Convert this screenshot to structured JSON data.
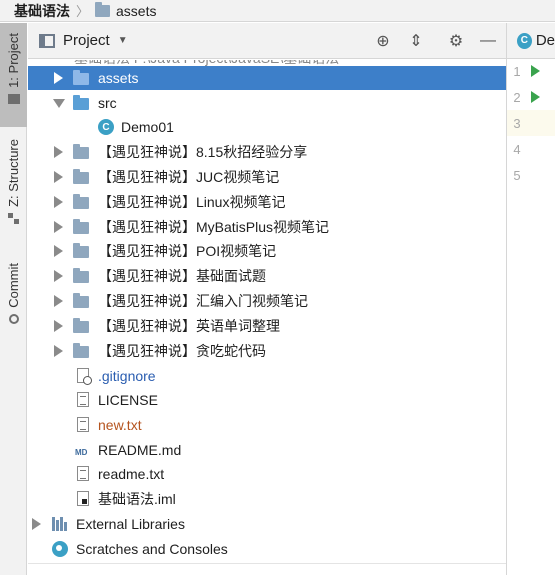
{
  "breadcrumb": {
    "root": "基础语法",
    "folder": "assets"
  },
  "tool_strip": {
    "project_tab": "1: Project",
    "structure_tab": "Z: Structure",
    "commit_tab": "Commit"
  },
  "panel": {
    "title": "Project",
    "header_hint": "基础语法  F:\\Java Project\\JavaSE\\基础语法"
  },
  "tree": [
    {
      "label": "assets",
      "kind": "folder",
      "expanded": false,
      "selected": true
    },
    {
      "label": "src",
      "kind": "source-folder",
      "expanded": true
    },
    {
      "label": "Demo01",
      "kind": "java-class"
    },
    {
      "label": "【遇见狂神说】8.15秋招经验分享",
      "kind": "folder",
      "expanded": false
    },
    {
      "label": "【遇见狂神说】JUC视频笔记",
      "kind": "folder",
      "expanded": false
    },
    {
      "label": "【遇见狂神说】Linux视频笔记",
      "kind": "folder",
      "expanded": false
    },
    {
      "label": "【遇见狂神说】MyBatisPlus视频笔记",
      "kind": "folder",
      "expanded": false
    },
    {
      "label": "【遇见狂神说】POI视频笔记",
      "kind": "folder",
      "expanded": false
    },
    {
      "label": "【遇见狂神说】基础面试题",
      "kind": "folder",
      "expanded": false
    },
    {
      "label": "【遇见狂神说】汇编入门视频笔记",
      "kind": "folder",
      "expanded": false
    },
    {
      "label": "【遇见狂神说】英语单词整理",
      "kind": "folder",
      "expanded": false
    },
    {
      "label": "【遇见狂神说】贪吃蛇代码",
      "kind": "folder",
      "expanded": false
    },
    {
      "label": ".gitignore",
      "kind": "gitignore",
      "color": "#2a5db0"
    },
    {
      "label": "LICENSE",
      "kind": "text-file"
    },
    {
      "label": "new.txt",
      "kind": "text-file",
      "color": "#b5541f"
    },
    {
      "label": "README.md",
      "kind": "markdown-file"
    },
    {
      "label": "readme.txt",
      "kind": "text-file"
    },
    {
      "label": "基础语法.iml",
      "kind": "iml-file"
    },
    {
      "label": "External Libraries",
      "kind": "libraries",
      "expanded": false
    },
    {
      "label": "Scratches and Consoles",
      "kind": "scratches"
    }
  ],
  "editor": {
    "tab_label": "De",
    "lines": [
      "1",
      "2",
      "3",
      "4",
      "5"
    ],
    "run_gutter_lines": [
      1,
      2
    ],
    "current_line": 3
  },
  "colors": {
    "selection": "#3d7fc9",
    "run_icon": "#3aa34d",
    "vcs_modified": "#2a5db0",
    "vcs_unversioned": "#b5541f"
  }
}
